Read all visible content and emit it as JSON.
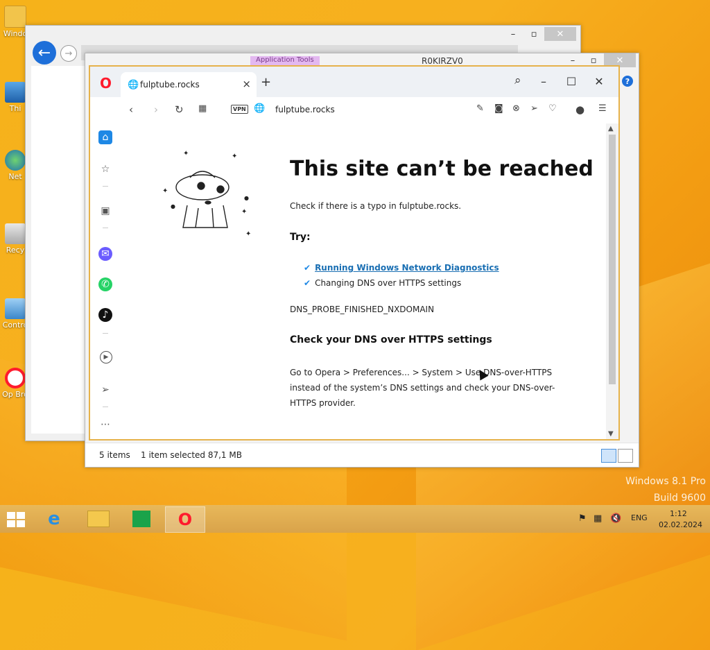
{
  "desktop": {
    "icons": [
      {
        "label": "Windo",
        "name": "desktop-icon-windows"
      },
      {
        "label": "Thi",
        "name": "desktop-icon-this-pc"
      },
      {
        "label": "Net",
        "name": "desktop-icon-network"
      },
      {
        "label": "Recy",
        "name": "desktop-icon-recycle-bin"
      },
      {
        "label": "Contro",
        "name": "desktop-icon-control-panel"
      },
      {
        "label": "Op Bro",
        "name": "desktop-icon-opera"
      }
    ],
    "watermark_line1": "Windows 8.1 Pro",
    "watermark_line2": "Build 9600"
  },
  "file_explorer": {
    "title": "R0KIRZV0",
    "app_tools": "Application Tools",
    "status_items": "5 items",
    "status_selected": "1 item selected  87,1 MB"
  },
  "opera": {
    "tab_title": "fulptube.rocks",
    "vpn_label": "VPN",
    "url": "fulptube.rocks",
    "error": {
      "heading": "This site can’t be reached",
      "subtitle": "Check if there is a typo in fulptube.rocks.",
      "try_label": "Try:",
      "suggestion_link": "Running Windows Network Diagnostics",
      "suggestion_2": "Changing DNS over HTTPS settings",
      "error_code": "DNS_PROBE_FINISHED_NXDOMAIN",
      "dns_heading": "Check your DNS over HTTPS settings",
      "dns_line1": "Go to Opera > Preferences... > System > Use DNS-over-HTTPS",
      "dns_line2": "instead of the system’s DNS settings and check your DNS-over-",
      "dns_line3": "HTTPS provider."
    }
  },
  "taskbar": {
    "language": "ENG",
    "time": "1:12",
    "date": "02.02.2024"
  },
  "colors": {
    "opera_red": "#ff1b2d",
    "link_blue": "#1a6fb3",
    "check_blue": "#1e88e5",
    "window_border": "#e6b24a"
  }
}
